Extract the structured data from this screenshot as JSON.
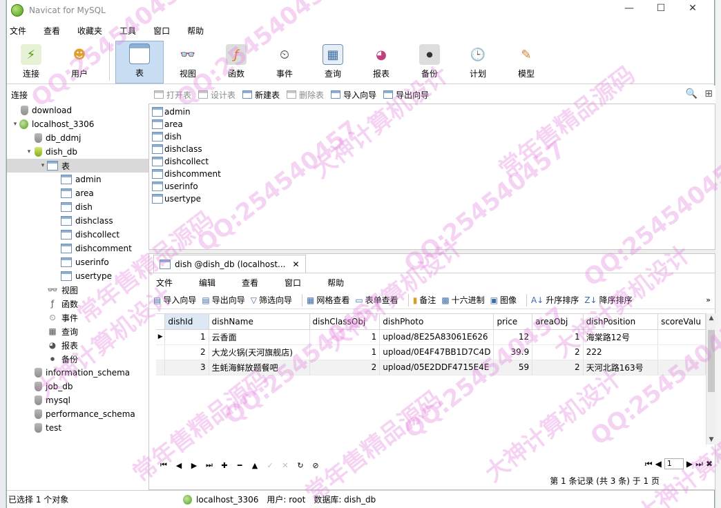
{
  "window": {
    "title": "Navicat for MySQL",
    "controls": [
      "—",
      "☐",
      "✕"
    ]
  },
  "menubar": [
    "文件",
    "查看",
    "收藏夹",
    "工具",
    "窗口",
    "帮助"
  ],
  "toolbar": {
    "connect": "连接",
    "user": "用户",
    "table": "表",
    "view": "视图",
    "function": "函数",
    "event": "事件",
    "query": "查询",
    "report": "报表",
    "backup": "备份",
    "schedule": "计划",
    "model": "模型"
  },
  "left_header": "连接",
  "tree": [
    {
      "label": "download",
      "level": 0,
      "type": "db",
      "expanded": null
    },
    {
      "label": "localhost_3306",
      "level": 0,
      "type": "conn",
      "expanded": true
    },
    {
      "label": "db_ddmj",
      "level": 1,
      "type": "db",
      "expanded": null
    },
    {
      "label": "dish_db",
      "level": 1,
      "type": "db-open",
      "expanded": true
    },
    {
      "label": "表",
      "level": 2,
      "type": "tables",
      "expanded": true,
      "selected": true
    },
    {
      "label": "admin",
      "level": 3,
      "type": "table"
    },
    {
      "label": "area",
      "level": 3,
      "type": "table"
    },
    {
      "label": "dish",
      "level": 3,
      "type": "table"
    },
    {
      "label": "dishclass",
      "level": 3,
      "type": "table"
    },
    {
      "label": "dishcollect",
      "level": 3,
      "type": "table"
    },
    {
      "label": "dishcomment",
      "level": 3,
      "type": "table"
    },
    {
      "label": "userinfo",
      "level": 3,
      "type": "table"
    },
    {
      "label": "usertype",
      "level": 3,
      "type": "table"
    },
    {
      "label": "视图",
      "level": 2,
      "type": "view"
    },
    {
      "label": "函数",
      "level": 2,
      "type": "func"
    },
    {
      "label": "事件",
      "level": 2,
      "type": "event"
    },
    {
      "label": "查询",
      "level": 2,
      "type": "query"
    },
    {
      "label": "报表",
      "level": 2,
      "type": "report"
    },
    {
      "label": "备份",
      "level": 2,
      "type": "backup"
    },
    {
      "label": "information_schema",
      "level": 1,
      "type": "db"
    },
    {
      "label": "job_db",
      "level": 1,
      "type": "db"
    },
    {
      "label": "mysql",
      "level": 1,
      "type": "db"
    },
    {
      "label": "performance_schema",
      "level": 1,
      "type": "db"
    },
    {
      "label": "test",
      "level": 1,
      "type": "db"
    }
  ],
  "object_toolbar": {
    "open": "打开表",
    "design": "设计表",
    "new": "新建表",
    "delete": "删除表",
    "import": "导入向导",
    "export": "导出向导"
  },
  "object_list": [
    "admin",
    "area",
    "dish",
    "dishclass",
    "dishcollect",
    "dishcomment",
    "userinfo",
    "usertype"
  ],
  "tab": {
    "title": "dish @dish_db (localhost...",
    "close": "✕"
  },
  "inner_menu": [
    "文件",
    "编辑",
    "查看",
    "窗口",
    "帮助"
  ],
  "inner_toolbar": {
    "import": "导入向导",
    "export": "导出向导",
    "filter": "筛选向导",
    "grid": "网格查看",
    "form": "表单查看",
    "memo": "备注",
    "hex": "十六进制",
    "image": "图像",
    "asc": "升序排序",
    "desc": "降序排序"
  },
  "grid": {
    "columns": [
      "dishId",
      "dishName",
      "dishClassObj",
      "dishPhoto",
      "price",
      "areaObj",
      "dishPosition",
      "scoreValu"
    ],
    "rows": [
      [
        "1",
        "云香面",
        "1",
        "upload/8E25A83061E626",
        "12",
        "1",
        "海棠路12号",
        ""
      ],
      [
        "2",
        "大龙火锅(天河旗舰店)",
        "1",
        "upload/0E4F47BB1D7C4D",
        "39.9",
        "2",
        "222",
        ""
      ],
      [
        "3",
        "生蚝海鲜放题餐吧",
        "2",
        "upload/05E2DDF4715E4E",
        "59",
        "2",
        "天河北路163号",
        ""
      ]
    ]
  },
  "nav": {
    "page": "1",
    "record_info": "第 1 条记录 (共 3 条) 于 1 页"
  },
  "status": {
    "selection": "已选择 1 个对象",
    "connection": "localhost_3306",
    "user": "用户: root",
    "database": "数据库: dish_db"
  },
  "watermark": [
    "QQ:254540457",
    "大神计算机设计",
    "常年售精品源码"
  ]
}
